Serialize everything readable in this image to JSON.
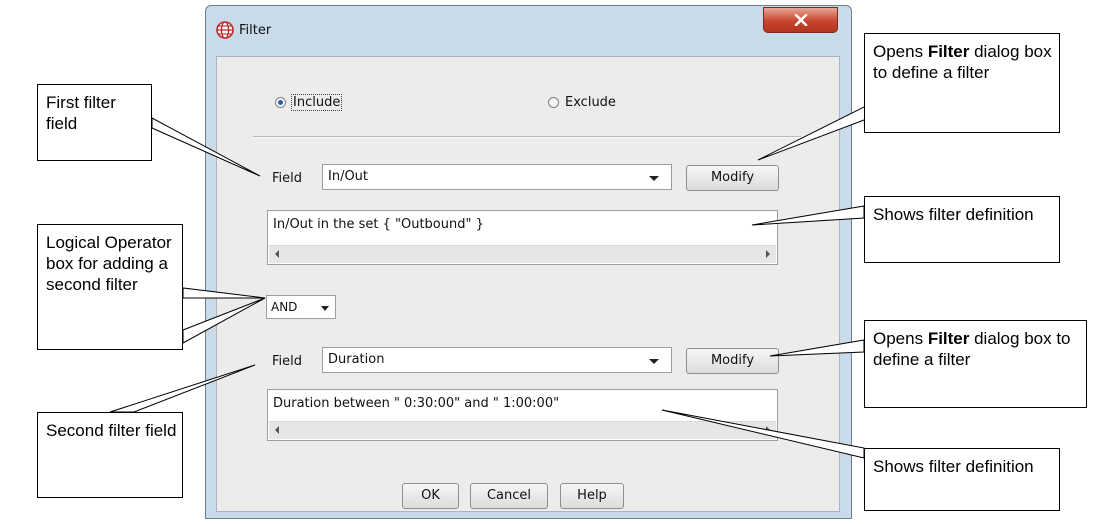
{
  "window": {
    "title": "Filter",
    "app_icon": "globe-icon",
    "close_icon": "close-icon"
  },
  "mode": {
    "include_label": "Include",
    "exclude_label": "Exclude",
    "selected": "Include"
  },
  "filter1": {
    "field_label": "Field",
    "field_value": "In/Out",
    "modify_label": "Modify",
    "definition": "In/Out in the set { \"Outbound\" }"
  },
  "logical_operator": {
    "value": "AND"
  },
  "filter2": {
    "field_label": "Field",
    "field_value": "Duration",
    "modify_label": "Modify",
    "definition": "Duration between \" 0:30:00\" and \" 1:00:00\""
  },
  "footer": {
    "ok_label": "OK",
    "cancel_label": "Cancel",
    "help_label": "Help"
  },
  "callouts": {
    "first_filter": "First filter field",
    "logical_operator": "Logical Operator box for adding a second filter",
    "second_filter": "Second filter field",
    "modify_top": {
      "pre": "Opens ",
      "bold": "Filter",
      "post": " dialog box to define a filter"
    },
    "definition_top": "Shows filter definition",
    "modify_bottom": {
      "pre": "Opens ",
      "bold": "Filter",
      "post": " dialog box to define a filter"
    },
    "definition_bottom": "Shows filter definition"
  }
}
